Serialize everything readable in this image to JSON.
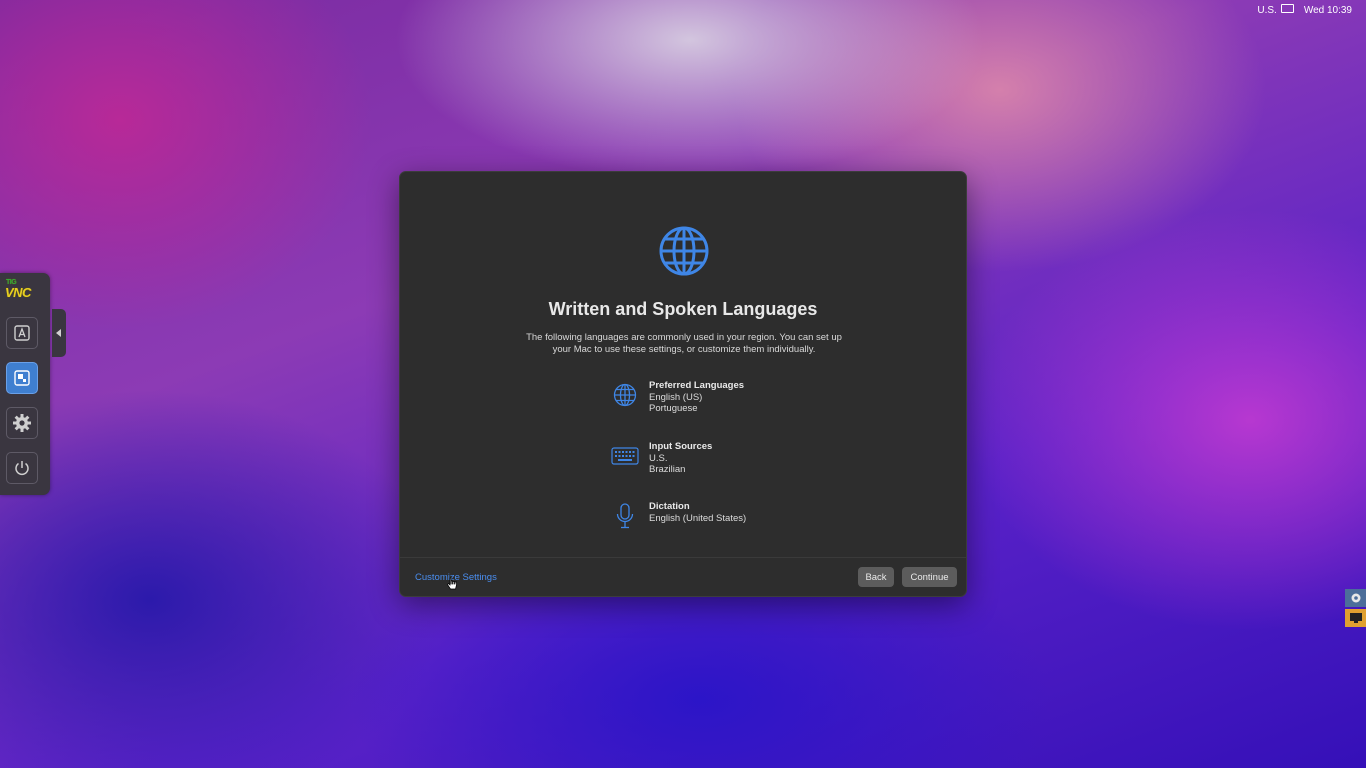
{
  "menubar": {
    "input_source": "U.S.",
    "clock": "Wed 10:39"
  },
  "dialog": {
    "title": "Written and Spoken Languages",
    "description": "The following languages are commonly used in your region. You can set up your Mac to use these settings, or customize them individually.",
    "settings": [
      {
        "heading": "Preferred Languages",
        "lines": [
          "English (US)",
          "Portuguese"
        ],
        "icon": "globe-icon"
      },
      {
        "heading": "Input Sources",
        "lines": [
          "U.S.",
          "Brazilian"
        ],
        "icon": "keyboard-icon"
      },
      {
        "heading": "Dictation",
        "lines": [
          "English (United States)"
        ],
        "icon": "microphone-icon"
      }
    ],
    "customize_link": "Customize Settings",
    "back_label": "Back",
    "continue_label": "Continue",
    "accent_color": "#3f86e6"
  },
  "vnc": {
    "logo_top": "TIG",
    "logo": "VNC",
    "buttons": [
      "keyboard-a-icon",
      "fit-screen-icon",
      "gear-icon",
      "power-icon"
    ]
  }
}
